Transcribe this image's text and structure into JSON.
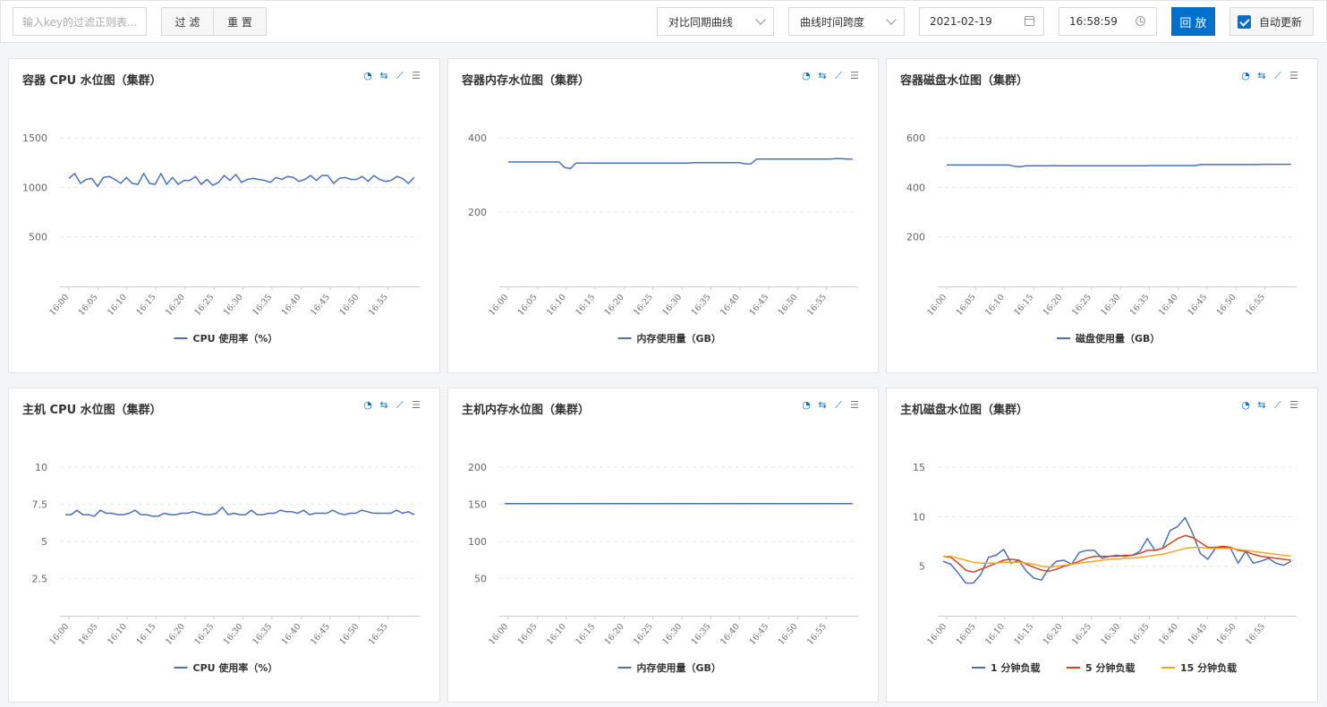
{
  "toolbar": {
    "search_placeholder": "输入key的过滤正则表...",
    "filter_label": "过 滤",
    "reset_label": "重 置",
    "compare_select": "对比同期曲线",
    "span_select": "曲线时间跨度",
    "date_value": "2021-02-19",
    "time_value": "16:58:59",
    "play_label": "回 放",
    "auto_update_label": "自动更新",
    "auto_update_checked": true
  },
  "panel_icons": [
    "pie-icon",
    "swap-icon",
    "line-chart-icon",
    "list-icon"
  ],
  "chart_data": [
    {
      "type": "line",
      "title": "容器 CPU 水位图（集群）",
      "x": [
        "16:00",
        "16:05",
        "16:10",
        "16:15",
        "16:20",
        "16:25",
        "16:30",
        "16:35",
        "16:40",
        "16:45",
        "16:50",
        "16:55"
      ],
      "yticks": [
        500,
        1000,
        1500
      ],
      "ylim": [
        0,
        1650
      ],
      "series": [
        {
          "name": "CPU 使用率（%）",
          "color": "#4a6fbf",
          "values": [
            1090,
            1140,
            1040,
            1080,
            1090,
            1010,
            1100,
            1110,
            1080,
            1040,
            1100,
            1040,
            1030,
            1140,
            1040,
            1030,
            1140,
            1030,
            1100,
            1030,
            1070,
            1070,
            1110,
            1030,
            1080,
            1020,
            1050,
            1120,
            1070,
            1130,
            1050,
            1080,
            1090,
            1080,
            1070,
            1050,
            1100,
            1080,
            1110,
            1100,
            1060,
            1080,
            1120,
            1070,
            1120,
            1120,
            1040,
            1090,
            1100,
            1080,
            1080,
            1110,
            1060,
            1120,
            1080,
            1060,
            1070,
            1110,
            1090,
            1040,
            1100
          ]
        }
      ]
    },
    {
      "type": "line",
      "title": "容器内存水位图（集群）",
      "x": [
        "16:00",
        "16:05",
        "16:10",
        "16:15",
        "16:20",
        "16:25",
        "16:30",
        "16:35",
        "16:40",
        "16:45",
        "16:50",
        "16:55"
      ],
      "yticks": [
        200,
        400
      ],
      "ylim": [
        0,
        440
      ],
      "series": [
        {
          "name": "内存使用量（GB）",
          "color": "#4a6fbf",
          "values": [
            335,
            335,
            335,
            335,
            335,
            335,
            335,
            335,
            335,
            335,
            320,
            317,
            332,
            332,
            332,
            332,
            332,
            332,
            332,
            332,
            332,
            332,
            332,
            332,
            332,
            332,
            332,
            332,
            332,
            332,
            332,
            332,
            332,
            333,
            333,
            333,
            333,
            333,
            333,
            333,
            333,
            333,
            330,
            330,
            343,
            343,
            343,
            343,
            343,
            343,
            343,
            343,
            343,
            343,
            343,
            343,
            343,
            343,
            344,
            344,
            343,
            343
          ]
        }
      ]
    },
    {
      "type": "line",
      "title": "容器磁盘水位图（集群）",
      "x": [
        "16:00",
        "16:05",
        "16:10",
        "16:15",
        "16:20",
        "16:25",
        "16:30",
        "16:35",
        "16:40",
        "16:45",
        "16:50",
        "16:55"
      ],
      "yticks": [
        200,
        400,
        600
      ],
      "ylim": [
        0,
        660
      ],
      "series": [
        {
          "name": "磁盘使用量（GB）",
          "color": "#4a6fbf",
          "values": [
            490,
            490,
            490,
            490,
            490,
            490,
            490,
            490,
            490,
            490,
            490,
            490,
            485,
            483,
            487,
            487,
            487,
            487,
            487,
            488,
            487,
            487,
            487,
            487,
            487,
            487,
            487,
            487,
            487,
            487,
            487,
            487,
            487,
            487,
            487,
            487,
            488,
            488,
            488,
            488,
            488,
            488,
            488,
            488,
            488,
            492,
            492,
            492,
            492,
            492,
            492,
            492,
            492,
            492,
            492,
            492,
            493,
            493,
            493,
            493,
            493,
            493
          ]
        }
      ]
    },
    {
      "type": "line",
      "title": "主机 CPU 水位图（集群）",
      "x": [
        "16:00",
        "16:05",
        "16:10",
        "16:15",
        "16:20",
        "16:25",
        "16:30",
        "16:35",
        "16:40",
        "16:45",
        "16:50",
        "16:55"
      ],
      "yticks": [
        2.5,
        5,
        7.5,
        10
      ],
      "ylim": [
        0,
        11
      ],
      "series": [
        {
          "name": "CPU 使用率（%）",
          "color": "#4a6fbf",
          "values": [
            6.8,
            6.8,
            7.1,
            6.8,
            6.8,
            6.7,
            7.1,
            6.9,
            6.9,
            6.8,
            6.8,
            6.9,
            7.1,
            6.8,
            6.8,
            6.7,
            6.7,
            6.9,
            6.8,
            6.8,
            6.9,
            6.9,
            7.0,
            6.9,
            6.8,
            6.8,
            6.9,
            7.3,
            6.8,
            6.9,
            6.8,
            6.8,
            7.1,
            6.8,
            6.8,
            6.9,
            6.9,
            7.1,
            7.0,
            7.0,
            6.9,
            7.1,
            6.8,
            6.9,
            6.9,
            6.9,
            7.1,
            6.9,
            6.8,
            6.9,
            6.9,
            7.1,
            7.0,
            6.9,
            6.9,
            6.9,
            6.9,
            7.1,
            6.9,
            7.0,
            6.8
          ]
        }
      ]
    },
    {
      "type": "line",
      "title": "主机内存水位图（集群）",
      "x": [
        "16:00",
        "16:05",
        "16:10",
        "16:15",
        "16:20",
        "16:25",
        "16:30",
        "16:35",
        "16:40",
        "16:45",
        "16:50",
        "16:55"
      ],
      "yticks": [
        50,
        100,
        150,
        200
      ],
      "ylim": [
        0,
        220
      ],
      "series": [
        {
          "name": "内存使用量（GB）",
          "color": "#4a6fbf",
          "values": [
            151,
            151,
            151,
            151,
            151,
            151,
            151,
            151,
            151,
            151,
            151,
            151,
            151,
            151,
            151,
            151,
            151,
            151,
            151,
            151,
            151,
            151,
            151,
            151,
            151,
            151,
            151,
            151,
            151,
            151,
            151,
            151,
            151,
            151,
            151,
            151,
            151,
            151,
            151,
            151,
            151,
            151,
            151,
            151,
            151,
            151,
            151,
            151,
            151,
            151,
            151,
            151,
            151,
            151,
            151,
            151,
            151,
            151,
            151,
            151,
            151
          ]
        }
      ]
    },
    {
      "type": "line",
      "title": "主机磁盘水位图（集群）",
      "x": [
        "16:00",
        "16:05",
        "16:10",
        "16:15",
        "16:20",
        "16:25",
        "16:30",
        "16:35",
        "16:40",
        "16:45",
        "16:50",
        "16:55"
      ],
      "yticks": [
        5,
        10,
        15
      ],
      "ylim": [
        0,
        16.5
      ],
      "series": [
        {
          "name": "1 分钟负载",
          "color": "#4a6fbf",
          "values": [
            5.5,
            5.2,
            4.3,
            3.3,
            3.3,
            4.2,
            5.9,
            6.1,
            6.7,
            5.3,
            5.6,
            4.5,
            3.8,
            3.6,
            4.8,
            5.5,
            5.6,
            5.2,
            6.4,
            6.6,
            6.6,
            5.8,
            6.0,
            6.1,
            6.0,
            6.1,
            6.5,
            7.8,
            6.6,
            6.8,
            8.6,
            9.0,
            9.9,
            8.3,
            6.3,
            5.7,
            6.8,
            6.9,
            6.8,
            5.3,
            6.5,
            5.3,
            5.5,
            5.8,
            5.3,
            5.1,
            5.5
          ]
        },
        {
          "name": "5 分钟负载",
          "color": "#d9421a",
          "values": [
            6.0,
            5.9,
            5.3,
            4.6,
            4.4,
            4.7,
            5.0,
            5.3,
            5.6,
            5.7,
            5.6,
            5.2,
            4.9,
            4.6,
            4.5,
            4.7,
            5.0,
            5.2,
            5.5,
            5.8,
            6.0,
            6.0,
            6.0,
            6.0,
            6.1,
            6.1,
            6.3,
            6.6,
            6.6,
            6.8,
            7.3,
            7.8,
            8.1,
            7.9,
            7.4,
            6.9,
            6.9,
            7.0,
            6.9,
            6.6,
            6.5,
            6.2,
            6.0,
            5.9,
            5.8,
            5.7,
            5.6
          ]
        },
        {
          "name": "15 分钟负载",
          "color": "#f5a623",
          "values": [
            6.0,
            6.0,
            5.8,
            5.6,
            5.4,
            5.3,
            5.3,
            5.3,
            5.4,
            5.4,
            5.4,
            5.3,
            5.2,
            5.0,
            4.9,
            5.0,
            5.1,
            5.2,
            5.3,
            5.4,
            5.5,
            5.6,
            5.7,
            5.7,
            5.8,
            5.8,
            5.9,
            6.0,
            6.1,
            6.2,
            6.4,
            6.6,
            6.8,
            6.9,
            6.9,
            6.8,
            6.8,
            6.8,
            6.8,
            6.7,
            6.6,
            6.5,
            6.4,
            6.3,
            6.2,
            6.1,
            6.0
          ]
        }
      ]
    }
  ]
}
